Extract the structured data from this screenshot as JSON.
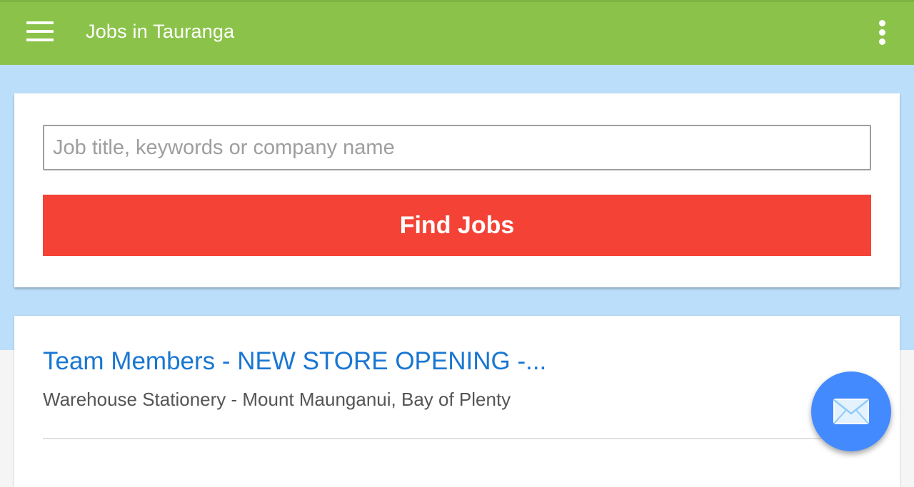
{
  "app_bar": {
    "title": "Jobs in Tauranga",
    "menu_icon": "hamburger-menu-icon",
    "overflow_icon": "more-vert-icon",
    "color": "#8bc34a"
  },
  "search": {
    "placeholder": "Job title, keywords or company name",
    "value": "",
    "button_label": "Find Jobs",
    "button_color": "#f44336"
  },
  "jobs": [
    {
      "title": "Team Members - NEW STORE OPENING -...",
      "company_location": "Warehouse Stationery - Mount Maunganui, Bay of Plenty"
    }
  ],
  "fab": {
    "icon": "mail-icon",
    "color": "#448aff"
  },
  "colors": {
    "hero_background": "#bbdefb",
    "job_title": "#1976d2"
  }
}
